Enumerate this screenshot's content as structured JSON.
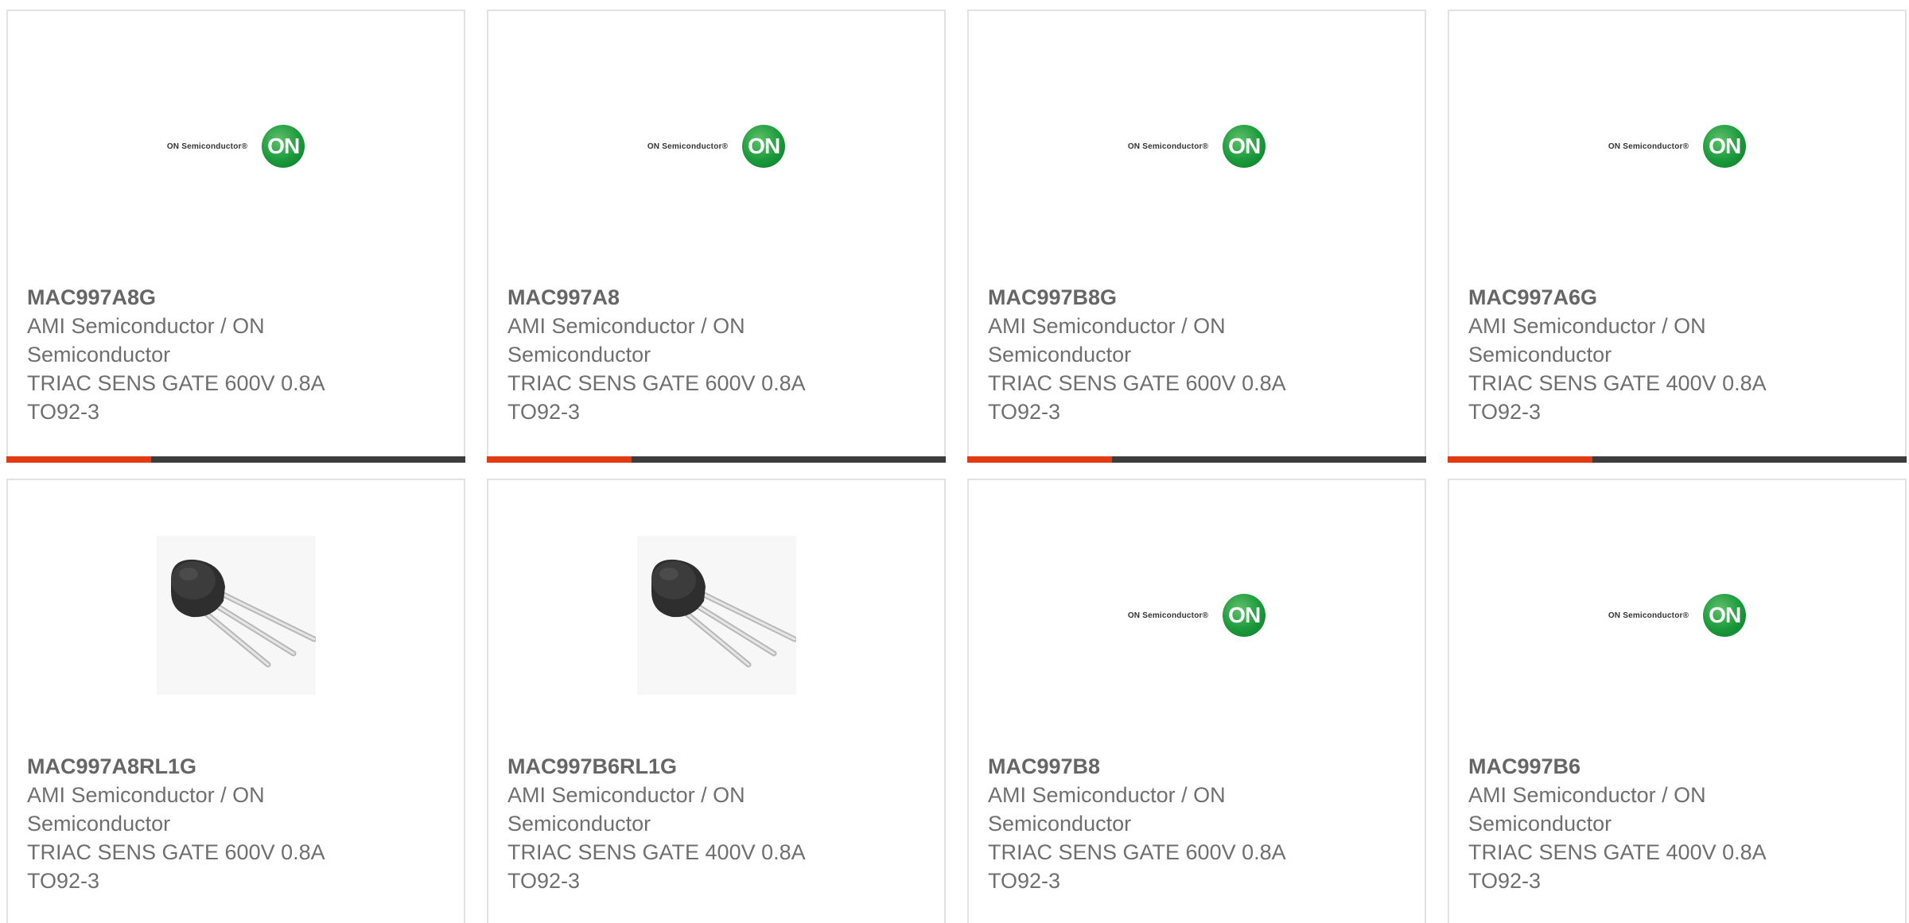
{
  "accent_color": "#e23a12",
  "bar_color": "#3d3d3d",
  "products": [
    {
      "part": "MAC997A8G",
      "manufacturer": "AMI Semiconductor / ON Semiconductor",
      "description": "TRIAC SENS GATE 600V 0.8A TO92-3",
      "image": "on-semiconductor-logo",
      "logo_text": "ON Semiconductor®",
      "logo_badge": "ON"
    },
    {
      "part": "MAC997A8",
      "manufacturer": "AMI Semiconductor / ON Semiconductor",
      "description": "TRIAC SENS GATE 600V 0.8A TO92-3",
      "image": "on-semiconductor-logo",
      "logo_text": "ON Semiconductor®",
      "logo_badge": "ON"
    },
    {
      "part": "MAC997B8G",
      "manufacturer": "AMI Semiconductor / ON Semiconductor",
      "description": "TRIAC SENS GATE 600V 0.8A TO92-3",
      "image": "on-semiconductor-logo",
      "logo_text": "ON Semiconductor®",
      "logo_badge": "ON"
    },
    {
      "part": "MAC997A6G",
      "manufacturer": "AMI Semiconductor / ON Semiconductor",
      "description": "TRIAC SENS GATE 400V 0.8A TO92-3",
      "image": "on-semiconductor-logo",
      "logo_text": "ON Semiconductor®",
      "logo_badge": "ON"
    },
    {
      "part": "MAC997A8RL1G",
      "manufacturer": "AMI Semiconductor / ON Semiconductor",
      "description": "TRIAC SENS GATE 600V 0.8A TO92-3",
      "image": "to92-transistor-photo"
    },
    {
      "part": "MAC997B6RL1G",
      "manufacturer": "AMI Semiconductor / ON Semiconductor",
      "description": "TRIAC SENS GATE 400V 0.8A TO92-3",
      "image": "to92-transistor-photo"
    },
    {
      "part": "MAC997B8",
      "manufacturer": "AMI Semiconductor / ON Semiconductor",
      "description": "TRIAC SENS GATE 600V 0.8A TO92-3",
      "image": "on-semiconductor-logo",
      "logo_text": "ON Semiconductor®",
      "logo_badge": "ON"
    },
    {
      "part": "MAC997B6",
      "manufacturer": "AMI Semiconductor / ON Semiconductor",
      "description": "TRIAC SENS GATE 400V 0.8A TO92-3",
      "image": "on-semiconductor-logo",
      "logo_text": "ON Semiconductor®",
      "logo_badge": "ON"
    }
  ]
}
